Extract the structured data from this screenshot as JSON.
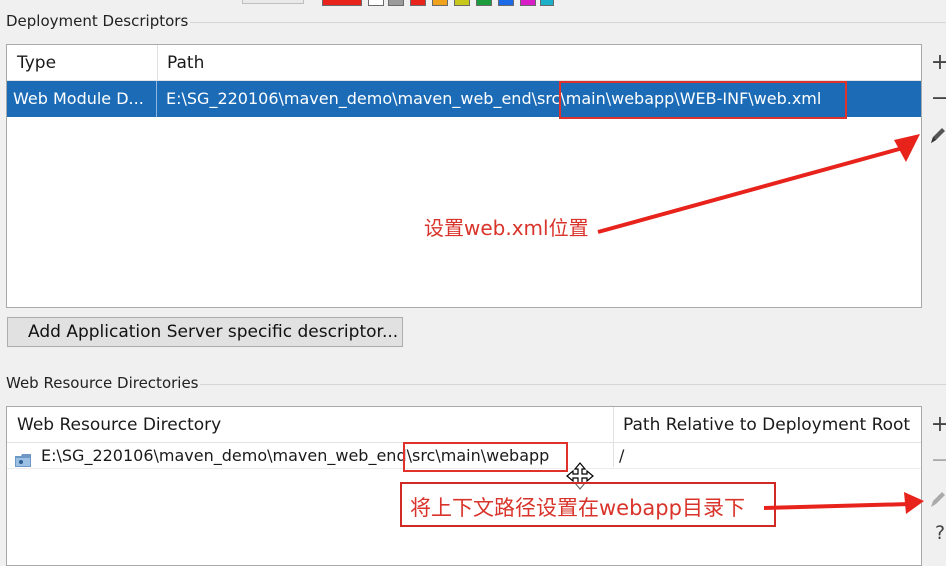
{
  "deployment": {
    "title": "Deployment Descriptors",
    "columns": [
      "Type",
      "Path"
    ],
    "row": {
      "type": "Web Module D...",
      "path_prefix": "E:\\SG_220106\\maven_demo\\maven_web_end\\src",
      "path_highlight": "\\main\\webapp\\WEB-INF\\web.xml"
    },
    "tools": {
      "add": "+",
      "remove": "−"
    },
    "add_descriptor_button": "Add Application Server specific descriptor..."
  },
  "web_resources": {
    "title": "Web Resource Directories",
    "columns": [
      "Web Resource Directory",
      "Path Relative to Deployment Root"
    ],
    "row": {
      "dir_prefix": "E:\\SG_220106\\maven_demo\\maven_web_end",
      "dir_highlight": "\\src\\main\\webapp",
      "relative_path": "/"
    },
    "tools": {
      "add": "+",
      "remove": "−",
      "help": "?"
    }
  },
  "annotations": {
    "web_xml_note": "设置web.xml位置",
    "webapp_note": "将上下文路径设置在webapp目录下"
  },
  "colors": {
    "selection": "#1b6bb6",
    "annotation_red": "#d9342b",
    "swatches": [
      "#e8231c",
      "#ffffff",
      "#9b9b9b",
      "#e8231c",
      "#f0a21c",
      "#c8c81c",
      "#1c9c3c",
      "#1c6ae8",
      "#d81cc8",
      "#1cb0c8"
    ]
  }
}
